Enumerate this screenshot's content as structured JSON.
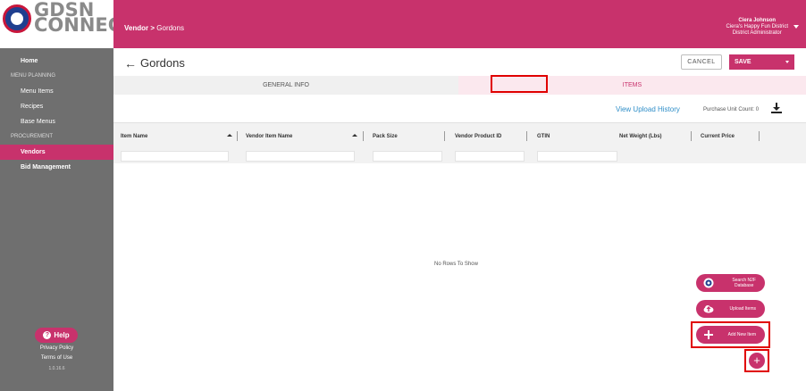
{
  "logo": {
    "line1": "GDSN",
    "line2": "CONNECT"
  },
  "sidebar": {
    "items": [
      {
        "label": "Home",
        "kind": "item"
      },
      {
        "label": "MENU PLANNING",
        "kind": "section"
      },
      {
        "label": "Menu Items",
        "kind": "item"
      },
      {
        "label": "Recipes",
        "kind": "item"
      },
      {
        "label": "Base Menus",
        "kind": "item"
      },
      {
        "label": "PROCUREMENT",
        "kind": "section"
      },
      {
        "label": "Vendors",
        "kind": "active"
      },
      {
        "label": "Bid Management",
        "kind": "item"
      }
    ],
    "help_label": "Help",
    "privacy_label": "Privacy Policy",
    "terms_label": "Terms of Use",
    "version": "1.0.16.6"
  },
  "header": {
    "crumb_root": "Vendor",
    "crumb_sep": ">",
    "crumb_current": "Gordons",
    "user_name": "Ciera Johnson",
    "user_district": "Ciera's Happy Fun District",
    "user_role": "District Administrator"
  },
  "page": {
    "back_arrow": "←",
    "title": "Gordons",
    "cancel_label": "CANCEL",
    "save_label": "SAVE"
  },
  "tabs": {
    "general": "GENERAL INFO",
    "items": "ITEMS"
  },
  "toolbar": {
    "upload_history": "View Upload History",
    "unit_count": "Purchase Unit Count: 0"
  },
  "grid": {
    "columns": [
      "Item Name",
      "Vendor Item Name",
      "Pack Size",
      "Vendor Product ID",
      "GTIN",
      "Net Weight (Lbs)",
      "Current Price"
    ],
    "empty_text": "No Rows To Show"
  },
  "fab": {
    "search_l1": "Search N2F",
    "search_l2": "Database",
    "upload": "Upload Items",
    "add_new": "Add New Item",
    "plus": "+"
  },
  "colors": {
    "brand": "#c8326c",
    "sidebar": "#6f6f6f",
    "highlight": "#e00000",
    "link": "#2f8ec8"
  }
}
